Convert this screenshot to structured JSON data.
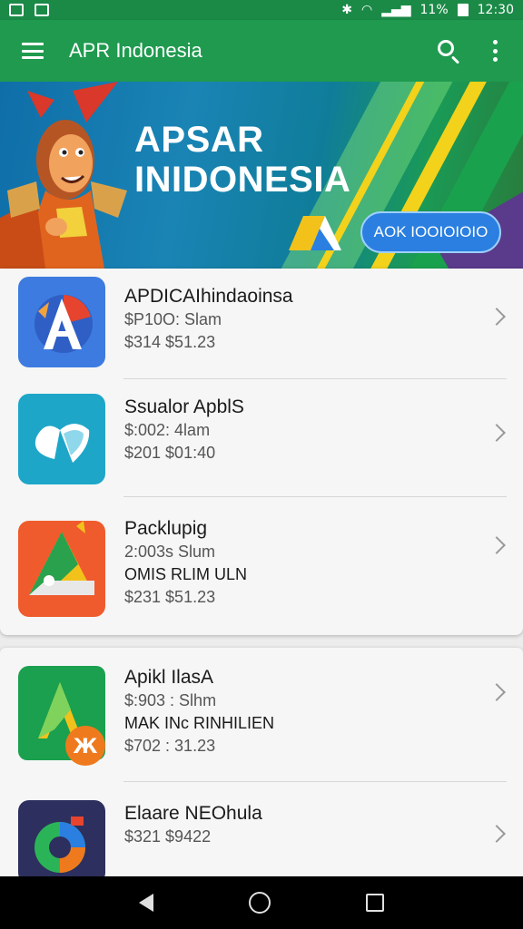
{
  "status_bar": {
    "time": "12:30",
    "battery": "11%",
    "icons": [
      "bluetooth-icon",
      "wifi-icon",
      "signal-icon",
      "battery-icon"
    ]
  },
  "appbar": {
    "title": "APR Indonesia"
  },
  "banner": {
    "title_line1": "APSAR",
    "title_line2": "INIDONESIA",
    "cta": "AOK IOOIOIOIO"
  },
  "apps": [
    {
      "name": "APDICAIhindaoinsa",
      "lines": [
        "$P10O: Slam",
        "$314 $51.23"
      ]
    },
    {
      "name": "Ssualor ApblS",
      "lines": [
        "$:002: 4lam",
        "$201 $01:40"
      ]
    },
    {
      "name": "Packlupig",
      "lines": [
        "2:003s Slum",
        "OMIS RLIM ULN",
        "$231 $51.23"
      ]
    },
    {
      "name": "Apikl IlasA",
      "lines": [
        "$:903 : Slhm",
        "MAK INc RINHILIEN",
        "$702 : 31.23"
      ]
    },
    {
      "name": "Elaare NEOhula",
      "lines": [
        "$321 $9422"
      ]
    }
  ],
  "colors": {
    "appbar": "#1f9a4f",
    "status": "#1b8a47",
    "cta": "#2a7fe0"
  }
}
